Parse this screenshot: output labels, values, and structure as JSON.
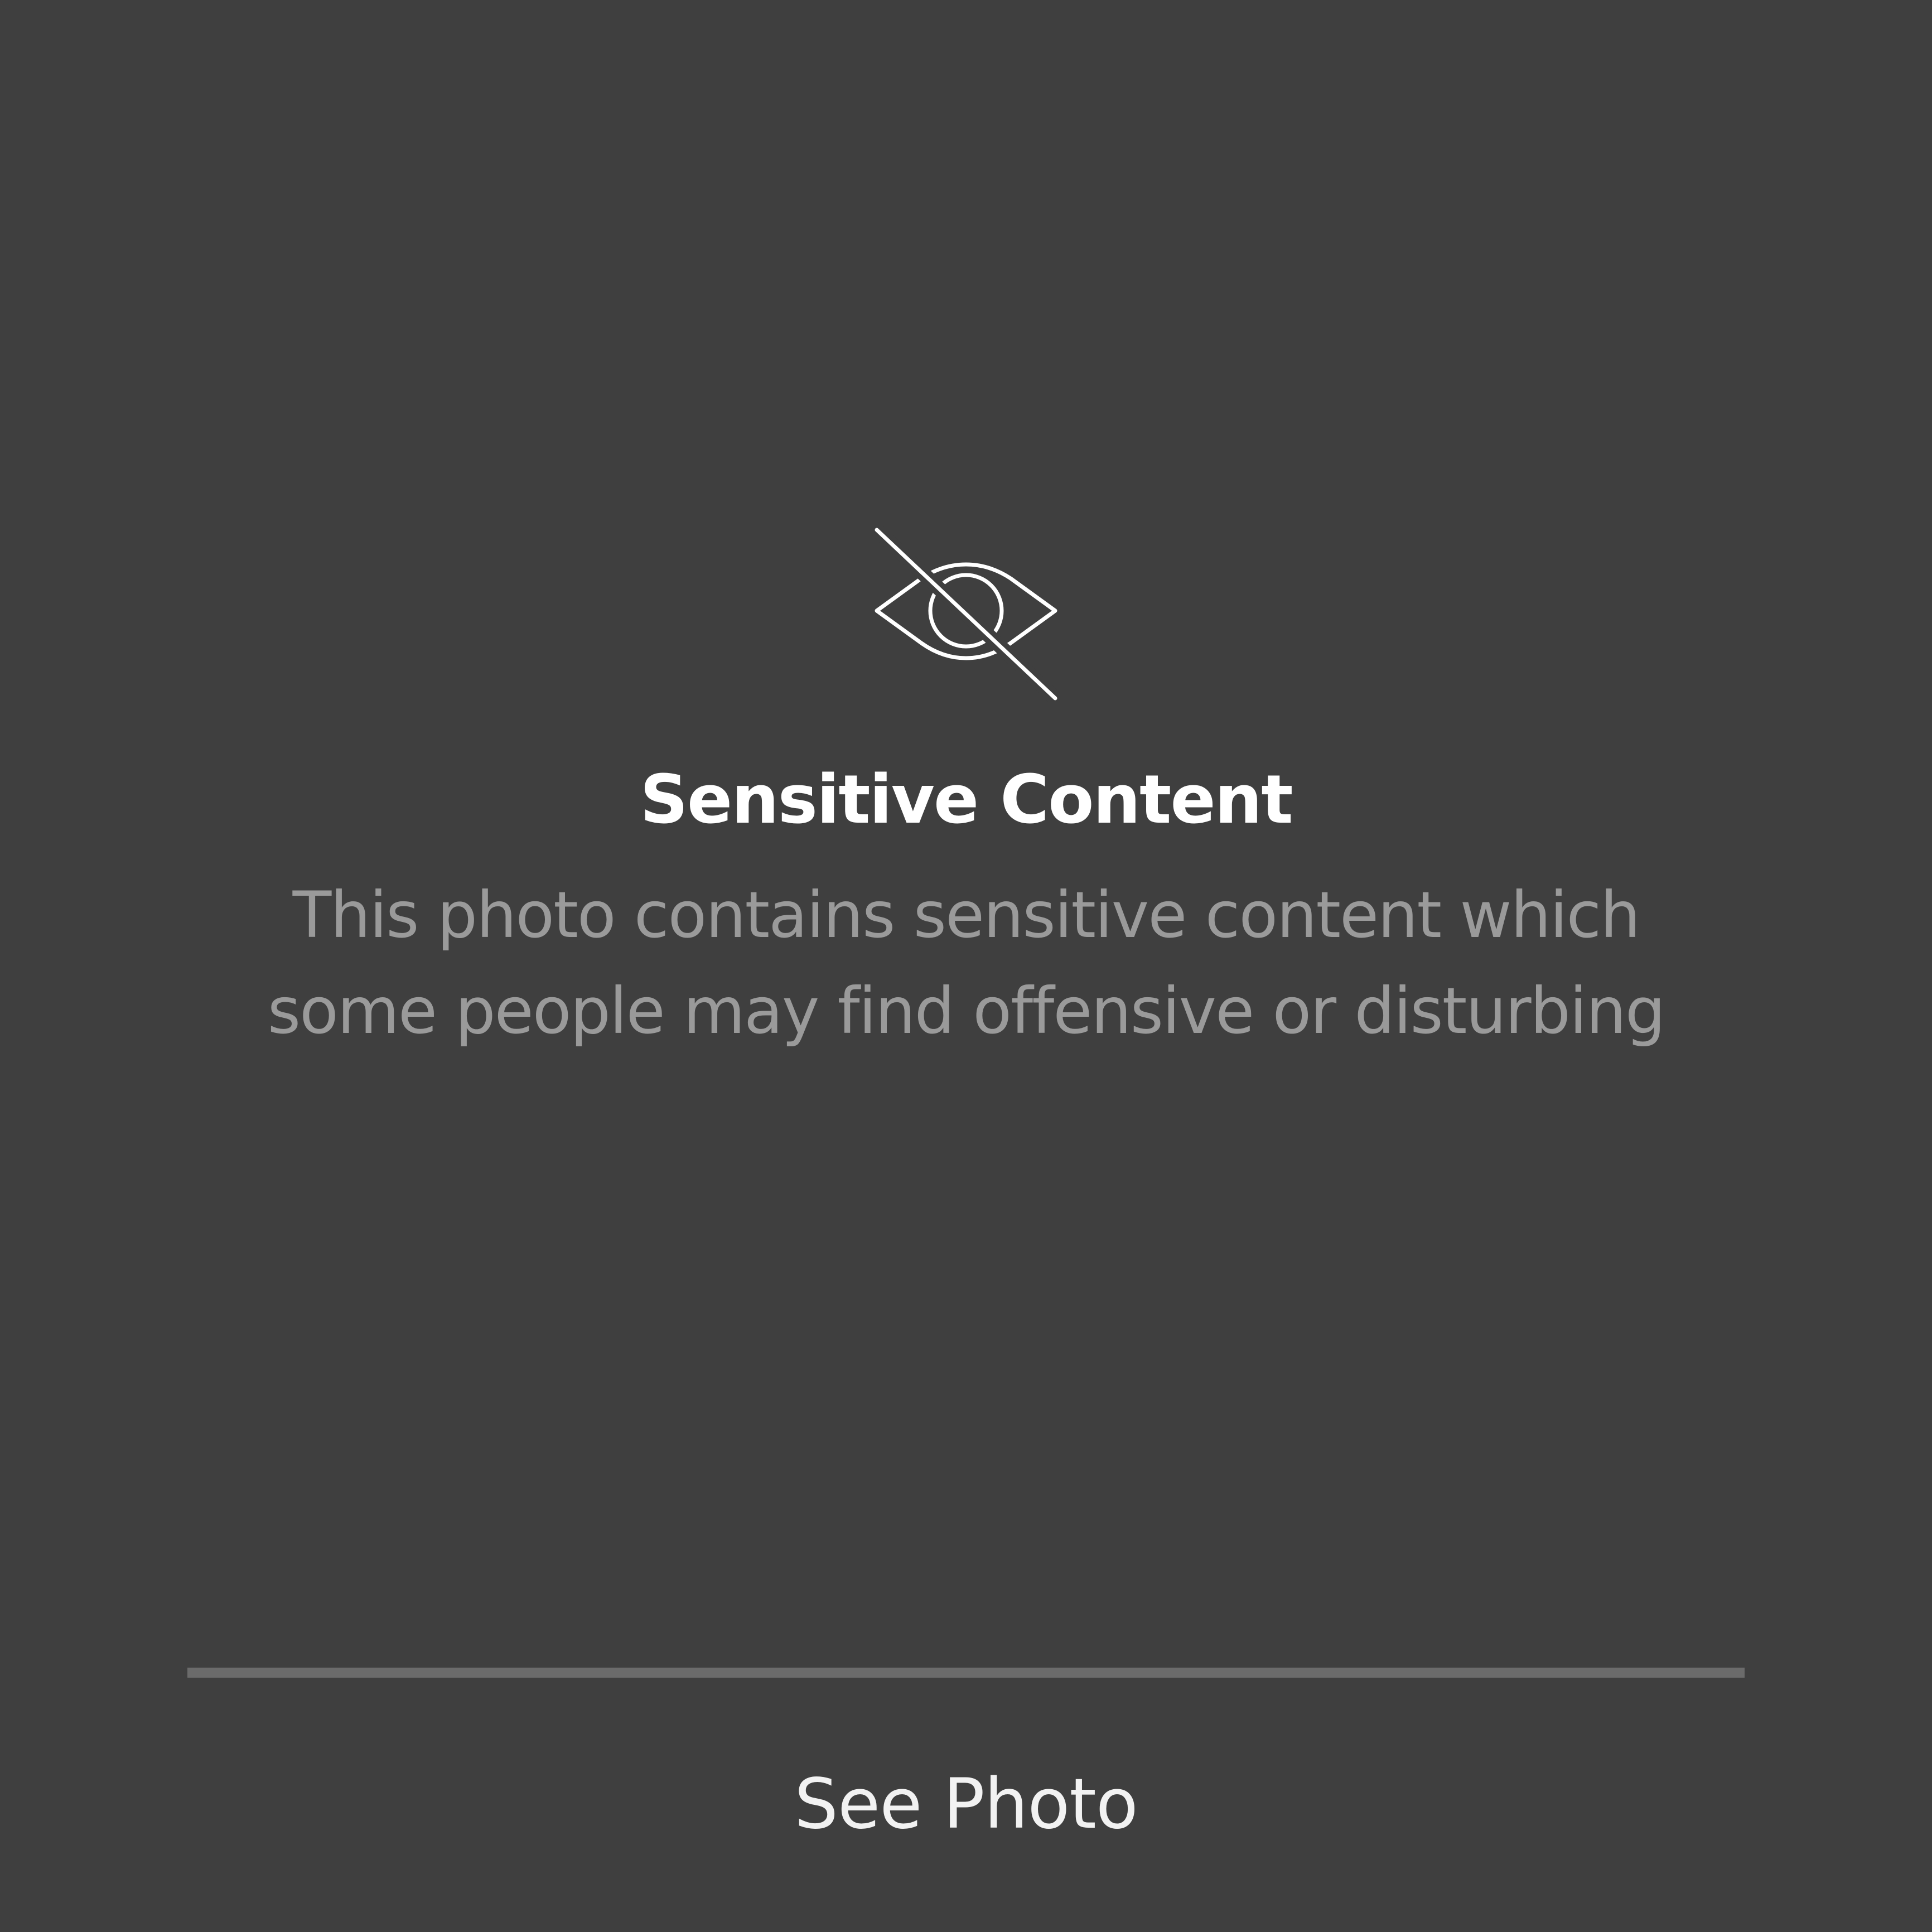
{
  "warning": {
    "icon": "eye-slash-icon",
    "title": "Sensitive Content",
    "description_line1": "This photo contains sensitive content which",
    "description_line2": "some people may find offensive or disturbing"
  },
  "actions": {
    "see_photo_label": "See Photo"
  },
  "colors": {
    "background": "#3f3f3f",
    "title": "#ffffff",
    "description": "#9a9a9a",
    "divider": "#6b6b6b"
  }
}
